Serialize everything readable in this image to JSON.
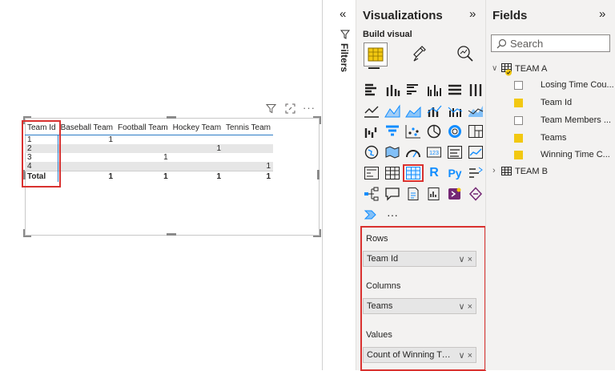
{
  "matrix": {
    "columns": [
      "Team Id",
      "Baseball Team",
      "Football Team",
      "Hockey Team",
      "Tennis Team"
    ],
    "rows": [
      {
        "id": "1",
        "values": [
          "1",
          "",
          "",
          ""
        ]
      },
      {
        "id": "2",
        "values": [
          "",
          "",
          "1",
          ""
        ]
      },
      {
        "id": "3",
        "values": [
          "",
          "1",
          "",
          ""
        ]
      },
      {
        "id": "4",
        "values": [
          "",
          "",
          "",
          "1"
        ]
      }
    ],
    "total": {
      "label": "Total",
      "values": [
        "1",
        "1",
        "1",
        "1"
      ]
    }
  },
  "filters": {
    "label": "Filters"
  },
  "visualizations": {
    "title": "Visualizations",
    "build_label": "Build visual",
    "wells": [
      {
        "label": "Rows",
        "value": "Team Id"
      },
      {
        "label": "Columns",
        "value": "Teams"
      },
      {
        "label": "Values",
        "value": "Count of Winning Tim..."
      }
    ],
    "accent_color": "#f2c811"
  },
  "fields": {
    "title": "Fields",
    "search_placeholder": "Search",
    "tables": [
      {
        "name": "TEAM A",
        "expanded": true,
        "fields": [
          {
            "name": "Losing Time Cou...",
            "checked": false
          },
          {
            "name": "Team Id",
            "checked": true
          },
          {
            "name": "Team Members ...",
            "checked": false
          },
          {
            "name": "Teams",
            "checked": true
          },
          {
            "name": "Winning Time C...",
            "checked": true
          }
        ]
      },
      {
        "name": "TEAM B",
        "expanded": false,
        "fields": []
      }
    ]
  }
}
